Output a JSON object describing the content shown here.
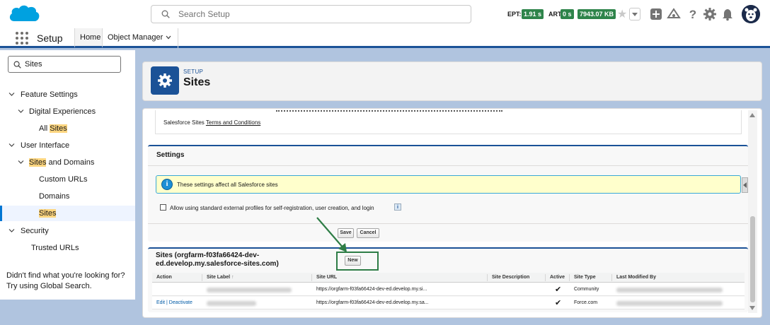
{
  "header": {
    "search_placeholder": "Search Setup",
    "metrics": [
      {
        "label": "EPT:",
        "value": "1.91 s"
      },
      {
        "label": "ART",
        "value": "0 s"
      },
      {
        "label": "",
        "value": "7943.07 KB"
      }
    ]
  },
  "context_bar": {
    "app_name": "Setup",
    "tabs": [
      {
        "label": "Home"
      },
      {
        "label": "Object Manager"
      }
    ]
  },
  "sidebar": {
    "quick_find_value": "Sites",
    "tree": [
      {
        "level": 0,
        "expanded": true,
        "label": "Feature Settings"
      },
      {
        "level": 1,
        "expanded": true,
        "label": "Digital Experiences"
      },
      {
        "level": 2,
        "label_prefix": "All ",
        "label_highlight": "Sites"
      },
      {
        "level": 0,
        "expanded": true,
        "label": "User Interface"
      },
      {
        "level": 1,
        "expanded": true,
        "label_highlight": "Sites",
        "label_suffix": " and Domains"
      },
      {
        "level": 2,
        "label": "Custom URLs"
      },
      {
        "level": 2,
        "label": "Domains"
      },
      {
        "level": 2,
        "label_highlight": "Sites",
        "selected": true
      },
      {
        "level": 0,
        "expanded": true,
        "label": "Security"
      },
      {
        "level": 1,
        "label": "Trusted URLs"
      }
    ],
    "help_text": "Didn't find what you're looking for? Try using Global Search."
  },
  "page_header": {
    "eyebrow": "SETUP",
    "title": "Sites"
  },
  "terms": {
    "prefix": "Salesforce Sites ",
    "link": "Terms and Conditions"
  },
  "settings": {
    "title": "Settings",
    "info_message": "These settings affect all Salesforce sites",
    "checkbox_label": "Allow using standard external profiles for self-registration, user creation, and login",
    "checkbox_checked": false,
    "save_label": "Save",
    "cancel_label": "Cancel"
  },
  "sites": {
    "title": "Sites (orgfarm-f03fa66424-dev-ed.develop.my.salesforce-sites.com)",
    "new_label": "New",
    "columns": [
      "Action",
      "Site Label",
      "Site URL",
      "Site Description",
      "Active",
      "Site Type",
      "Last Modified By"
    ],
    "rows": [
      {
        "action": "",
        "url": "https://orgfarm-f03fa66424-dev-ed.develop.my.si...",
        "description": "",
        "active": true,
        "type": "Community"
      },
      {
        "action_edit": "Edit",
        "action_sep": " | ",
        "action_deactivate": "Deactivate",
        "url": "https://orgfarm-f03fa66424-dev-ed.develop.my.sa...",
        "description": "",
        "active": true,
        "type": "Force.com"
      }
    ]
  },
  "colors": {
    "brand": "#1b5297",
    "metric_badge": "#2e844a",
    "highlight": "#fcd57f",
    "annotation": "#2e7d46"
  }
}
